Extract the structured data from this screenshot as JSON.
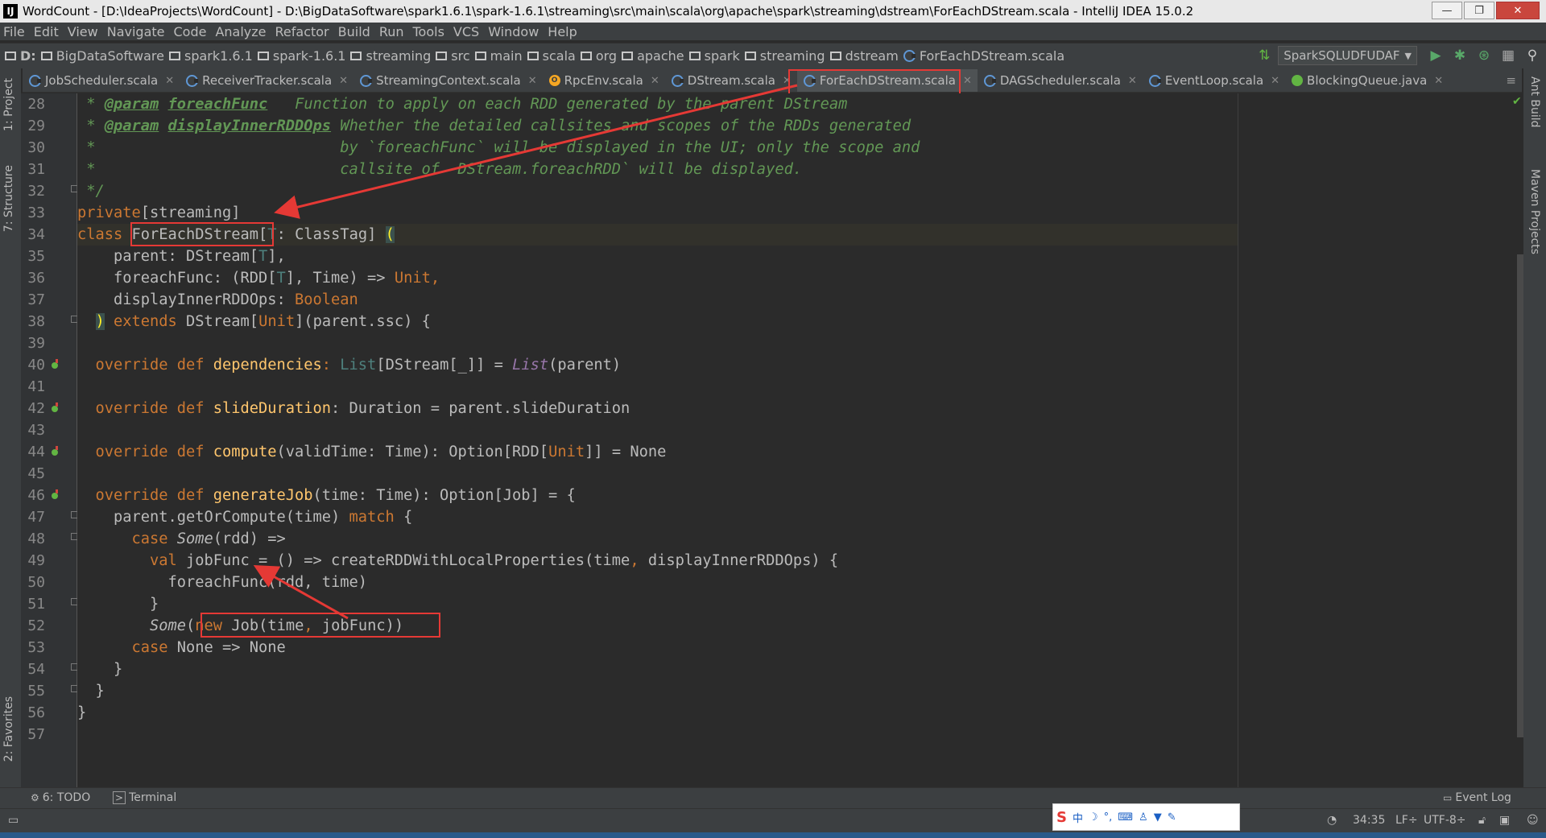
{
  "window": {
    "title": "WordCount - [D:\\IdeaProjects\\WordCount] - D:\\BigDataSoftware\\spark1.6.1\\spark-1.6.1\\streaming\\src\\main\\scala\\org\\apache\\spark\\streaming\\dstream\\ForEachDStream.scala - IntelliJ IDEA 15.0.2",
    "app_icon": "IJ",
    "minimize": "—",
    "maximize": "❐",
    "close": "✕"
  },
  "menu": [
    "File",
    "Edit",
    "View",
    "Navigate",
    "Code",
    "Analyze",
    "Refactor",
    "Build",
    "Run",
    "Tools",
    "VCS",
    "Window",
    "Help"
  ],
  "breadcrumbs": [
    "D:",
    "BigDataSoftware",
    "spark1.6.1",
    "spark-1.6.1",
    "streaming",
    "src",
    "main",
    "scala",
    "org",
    "apache",
    "spark",
    "streaming",
    "dstream",
    "ForEachDStream.scala"
  ],
  "toolbar": {
    "run_config": "SparkSQLUDFUDAF",
    "run_icon": "run-icon",
    "debug_icon": "debug-icon",
    "search_icon": "search-icon"
  },
  "tabs": [
    {
      "label": "JobScheduler.scala",
      "icon": "scala-class-icon"
    },
    {
      "label": "ReceiverTracker.scala",
      "icon": "scala-class-icon"
    },
    {
      "label": "StreamingContext.scala",
      "icon": "scala-class-icon"
    },
    {
      "label": "RpcEnv.scala",
      "icon": "scala-object-icon"
    },
    {
      "label": "DStream.scala",
      "icon": "scala-class-icon"
    },
    {
      "label": "ForEachDStream.scala",
      "icon": "scala-class-icon"
    },
    {
      "label": "DAGScheduler.scala",
      "icon": "scala-class-icon"
    },
    {
      "label": "EventLoop.scala",
      "icon": "scala-class-icon"
    },
    {
      "label": "BlockingQueue.java",
      "icon": "java-interface-icon"
    }
  ],
  "left_tool_windows": [
    "1: Project",
    "7: Structure",
    "2: Favorites"
  ],
  "right_tool_windows": [
    "Ant Build",
    "Maven Projects"
  ],
  "code": {
    "first_line_number": 28,
    "lines": [
      "28",
      "29",
      "30",
      "31",
      "32",
      "33",
      "34",
      "35",
      "36",
      "37",
      "38",
      "39",
      "40",
      "41",
      "42",
      "43",
      "44",
      "45",
      "46",
      "47",
      "48",
      "49",
      "50",
      "51",
      "52",
      "53",
      "54",
      "55",
      "56",
      "57"
    ],
    "text": {
      "l28a": " * ",
      "l28b": "@param",
      "l28c": " ",
      "l28d": "foreachFunc",
      "l28e": "   Function to apply on each RDD generated by the parent DStream",
      "l29a": " * ",
      "l29b": "@param",
      "l29c": " ",
      "l29d": "displayInnerRDDOps",
      "l29e": " Whether the detailed callsites and scopes of the RDDs generated",
      "l30": " *                           by `foreachFunc` will be displayed in the UI; only the scope and",
      "l31": " *                           callsite of  DStream.foreachRDD` will be displayed.",
      "l32": " */",
      "l33a": "private",
      "l33b": "[streaming]",
      "l34a": "class ",
      "l34b": "ForEachDStream",
      "l34c": "[",
      "l34d": "T",
      "l34e": ": ClassTag] ",
      "l34f": "(",
      "l35a": "    parent: DStream[",
      "l35b": "T",
      "l35c": "],",
      "l36a": "    foreachFunc: (RDD[",
      "l36b": "T",
      "l36c": "], Time) => ",
      "l36d": "Unit",
      "l36e": ",",
      "l37a": "    displayInnerRDDOps: ",
      "l37b": "Boolean",
      "l38a": "  ",
      "l38b": ")",
      "l38c": " extends ",
      "l38d": "DStream[",
      "l38e": "Unit",
      "l38f": "](parent.ssc) {",
      "l40a": "  override def ",
      "l40b": "dependencies",
      "l40c": ": ",
      "l40d": "List",
      "l40e": "[DStream[_]] = ",
      "l40f": "List",
      "l40g": "(parent)",
      "l42a": "  override def ",
      "l42b": "slideDuration",
      "l42c": ": Duration = parent.slideDuration",
      "l44a": "  override def ",
      "l44b": "compute",
      "l44c": "(validTime: Time): Option[RDD[",
      "l44d": "Unit",
      "l44e": "]] = None",
      "l46a": "  override def ",
      "l46b": "generateJob",
      "l46c": "(time: Time): Option[Job] = {",
      "l47a": "    parent.getOrCompute(time) ",
      "l47b": "match",
      "l47c": " {",
      "l48a": "      case ",
      "l48b": "Some",
      "l48c": "(rdd) =>",
      "l49a": "        val ",
      "l49b": "jobFunc = () => createRDDWithLocalProperties(time",
      "l49c": ",",
      "l49d": " displayInnerRDDOps) {",
      "l50": "          foreachFunc(rdd, time)",
      "l51": "        }",
      "l52a": "        ",
      "l52b": "Some",
      "l52c": "(",
      "l52d": "new ",
      "l52e": "Job(time",
      "l52f": ",",
      "l52g": " jobFunc))",
      "l53a": "      case ",
      "l53b": "None => None",
      "l54": "    }",
      "l55": "  }",
      "l56": "}"
    }
  },
  "bottom_tools": {
    "todo": "6: TODO",
    "terminal": "Terminal",
    "event_log": "Event Log"
  },
  "status": {
    "position": "34:35",
    "line_sep": "LF÷",
    "encoding": "UTF-8÷"
  },
  "ime": {
    "label": "中",
    "icons": [
      "moon-icon",
      "punct-icon",
      "keyboard-icon",
      "user-icon",
      "shirt-icon",
      "wrench-icon"
    ]
  }
}
